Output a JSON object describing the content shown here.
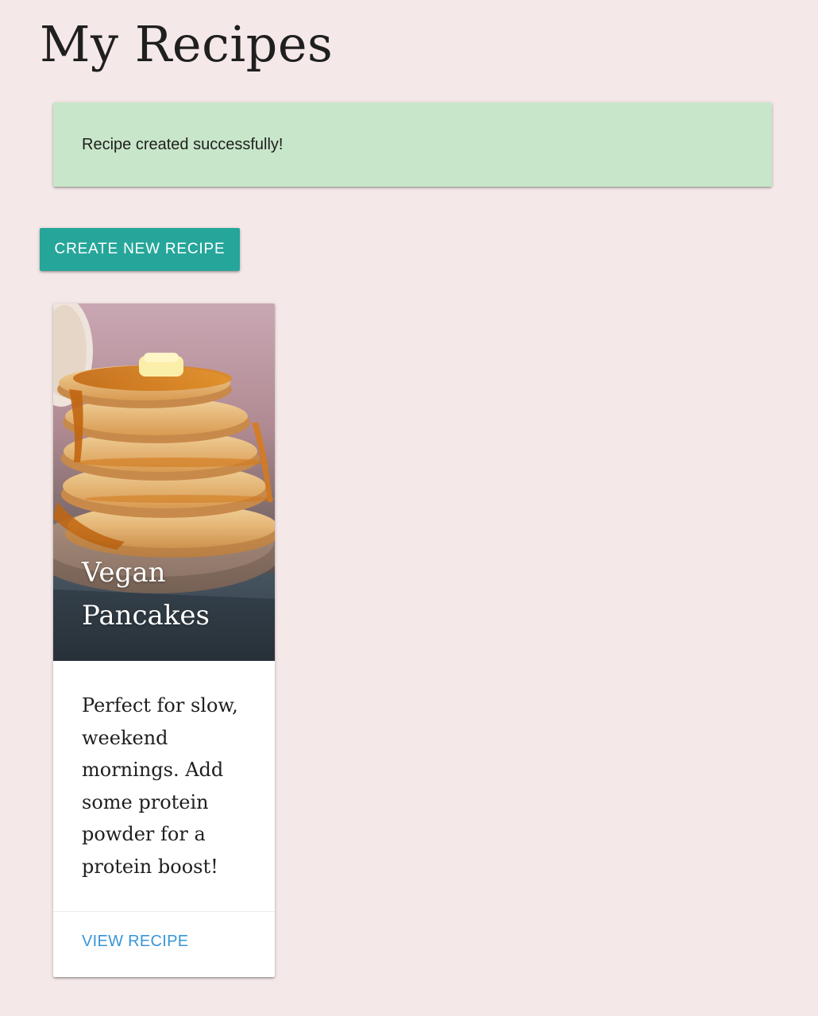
{
  "page": {
    "title": "My Recipes"
  },
  "alert": {
    "message": "Recipe created successfully!",
    "background": "#c8e6c9"
  },
  "actions": {
    "create_label": "CREATE NEW RECIPE",
    "create_color": "#26a69a"
  },
  "recipes": [
    {
      "title": "Vegan Pancakes",
      "description": "Perfect for slow, weekend mornings. Add some protein powder for a protein boost!",
      "image": "pancake-stack-photo",
      "action_label": "VIEW RECIPE",
      "action_color": "#3a96d8"
    }
  ]
}
